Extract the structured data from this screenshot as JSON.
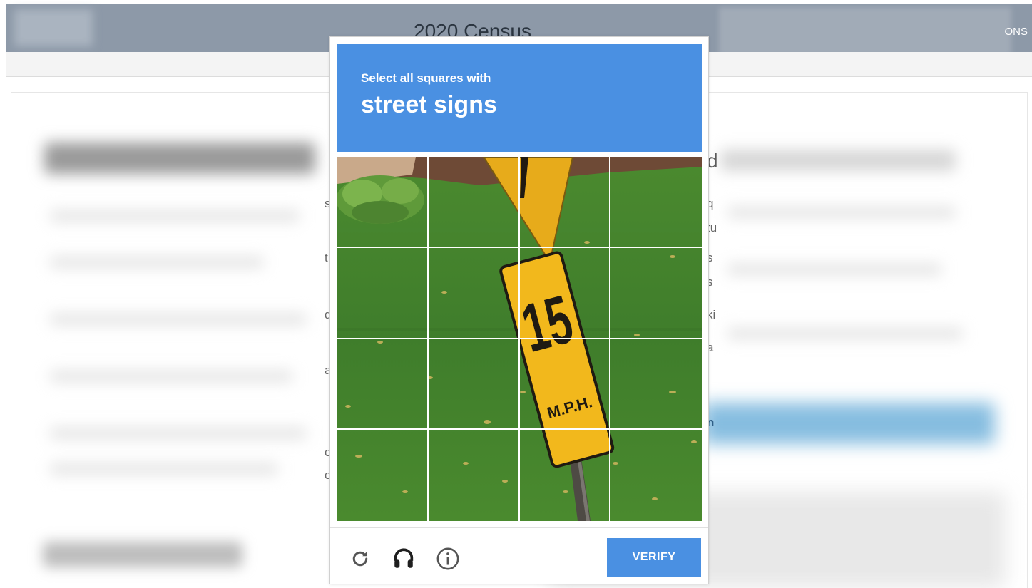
{
  "background_page": {
    "header_title": "2020 Census",
    "header_nav_fragment": "ONS",
    "left_text_fragments": [
      "s",
      "t",
      "d",
      "",
      "a",
      "",
      "",
      "c",
      "c"
    ],
    "right_text_fragments": [
      "d",
      "q",
      "tu",
      "s",
      "s",
      "ki",
      "a",
      "n"
    ]
  },
  "captcha": {
    "instruction_line": "Select all squares with",
    "target": "street signs",
    "grid": {
      "rows": 4,
      "cols": 4
    },
    "scene_text": {
      "sign_number": "15",
      "sign_unit": "M.P.H."
    },
    "footer": {
      "icons": [
        "reload-icon",
        "audio-headphones-icon",
        "info-icon"
      ],
      "verify_label": "VERIFY"
    },
    "colors": {
      "accent": "#4a90e2",
      "sign_yellow": "#f2b81c",
      "grass": "#3f7d2b"
    }
  }
}
